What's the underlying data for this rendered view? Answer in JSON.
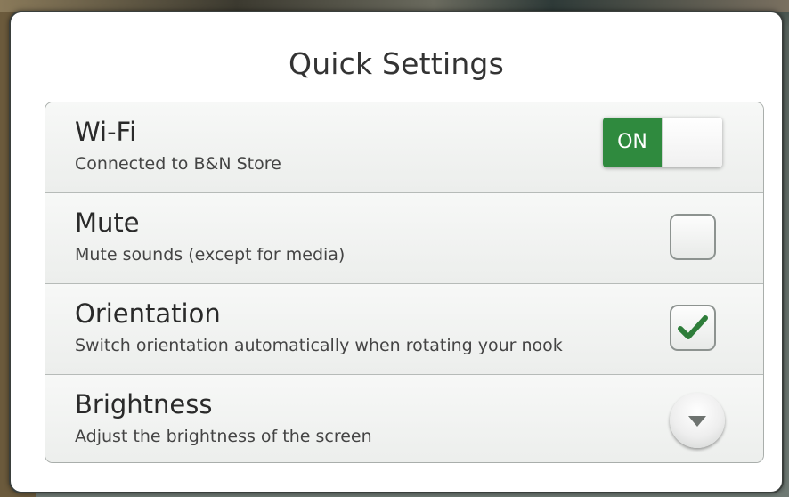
{
  "dialog": {
    "title": "Quick Settings"
  },
  "settings": [
    {
      "title": "Wi-Fi",
      "subtitle": "Connected to B&N Store",
      "control": "toggle",
      "state_label": "ON",
      "state": true
    },
    {
      "title": "Mute",
      "subtitle": "Mute sounds (except for media)",
      "control": "checkbox",
      "state": false
    },
    {
      "title": "Orientation",
      "subtitle": "Switch orientation automatically when rotating your nook",
      "control": "checkbox",
      "state": true
    },
    {
      "title": "Brightness",
      "subtitle": "Adjust the brightness of the screen",
      "control": "dropdown",
      "icon": "chevron-down-icon"
    }
  ],
  "colors": {
    "accent_green": "#2f8a3e",
    "check_green": "#2e7d3a"
  }
}
